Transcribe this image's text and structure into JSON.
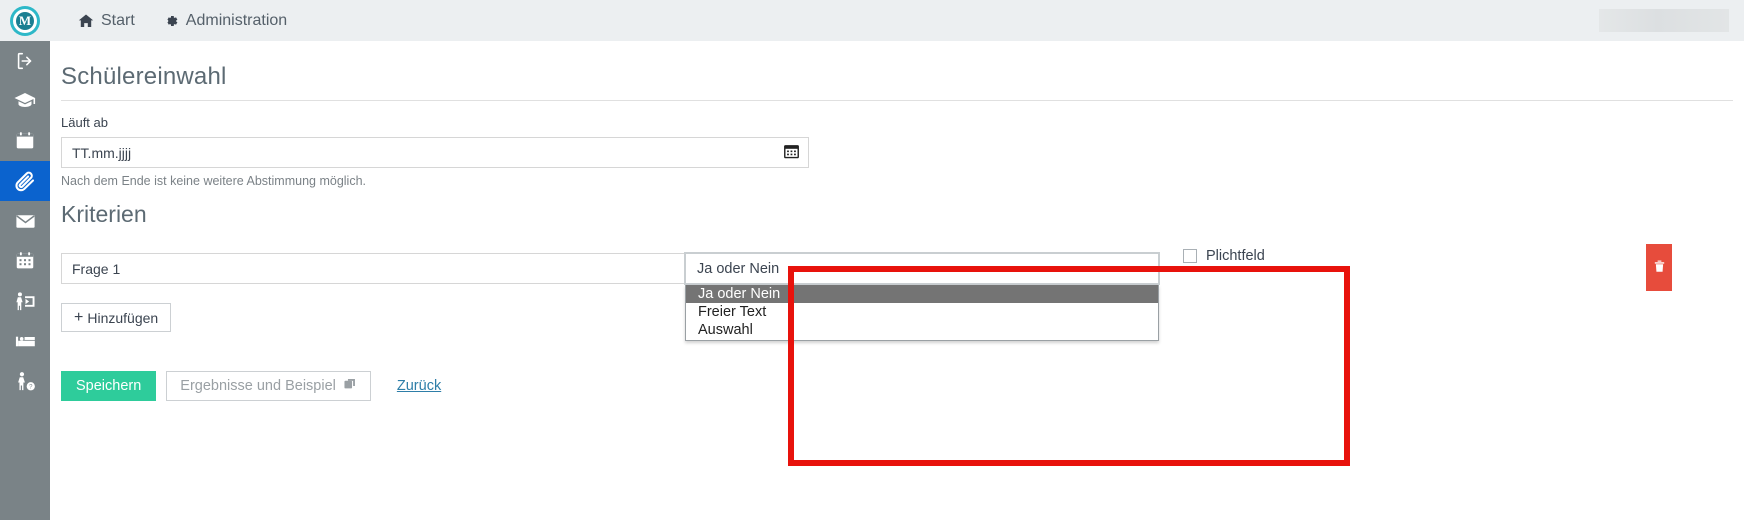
{
  "topbar": {
    "logo_letter": "M",
    "logo_icon": "circular-m-logo",
    "items": [
      {
        "label": "Start",
        "icon": "home-icon"
      },
      {
        "label": "Administration",
        "icon": "gear-icon"
      }
    ],
    "redacted_block": ""
  },
  "sidebar": {
    "items": [
      {
        "icon": "logout-icon",
        "active": false
      },
      {
        "icon": "graduation-cap-icon",
        "active": false
      },
      {
        "icon": "calendar-blank-icon",
        "active": false
      },
      {
        "icon": "paperclip-icon",
        "active": true
      },
      {
        "icon": "envelope-icon",
        "active": false
      },
      {
        "icon": "calendar-days-icon",
        "active": false
      },
      {
        "icon": "person-exit-icon",
        "active": false
      },
      {
        "icon": "bed-icon",
        "active": false
      },
      {
        "icon": "person-help-icon",
        "active": false
      }
    ]
  },
  "page": {
    "title": "Schülereinwahl",
    "expiry_label": "Läuft ab",
    "expiry_placeholder": "TT.mm.jjjj",
    "expiry_value": "",
    "expiry_help": "Nach dem Ende ist keine weitere Abstimmung möglich.",
    "calendar_icon": "calendar-icon",
    "section_title": "Kriterien"
  },
  "criteria": {
    "question_value": "Frage 1",
    "question_placeholder": "Frage 1",
    "type_select": {
      "value": "Ja oder Nein",
      "open": true,
      "caret_icon": "chevron-down-icon",
      "options": [
        {
          "label": "Ja oder Nein",
          "selected": true
        },
        {
          "label": "Freier Text",
          "selected": false
        },
        {
          "label": "Auswahl",
          "selected": false
        }
      ]
    },
    "required_label": "Plichtfeld",
    "required_checked": false,
    "delete_icon": "trash-icon"
  },
  "actions": {
    "add_label": "Hinzufügen",
    "add_plus": "+",
    "save_label": "Speichern",
    "results_label": "Ergebnisse und Beispiel",
    "results_icon": "external-window-icon",
    "back_label": "Zurück"
  },
  "colors": {
    "brand_teal": "#2eb8c8",
    "sidebar_bg": "#7a8387",
    "sidebar_active": "#0b63ce",
    "topbar_bg": "#eceff1",
    "save_green": "#2ecc9b",
    "delete_red": "#e74c3c",
    "annotation_red": "#e8120c",
    "option_selected_bg": "#747474"
  }
}
